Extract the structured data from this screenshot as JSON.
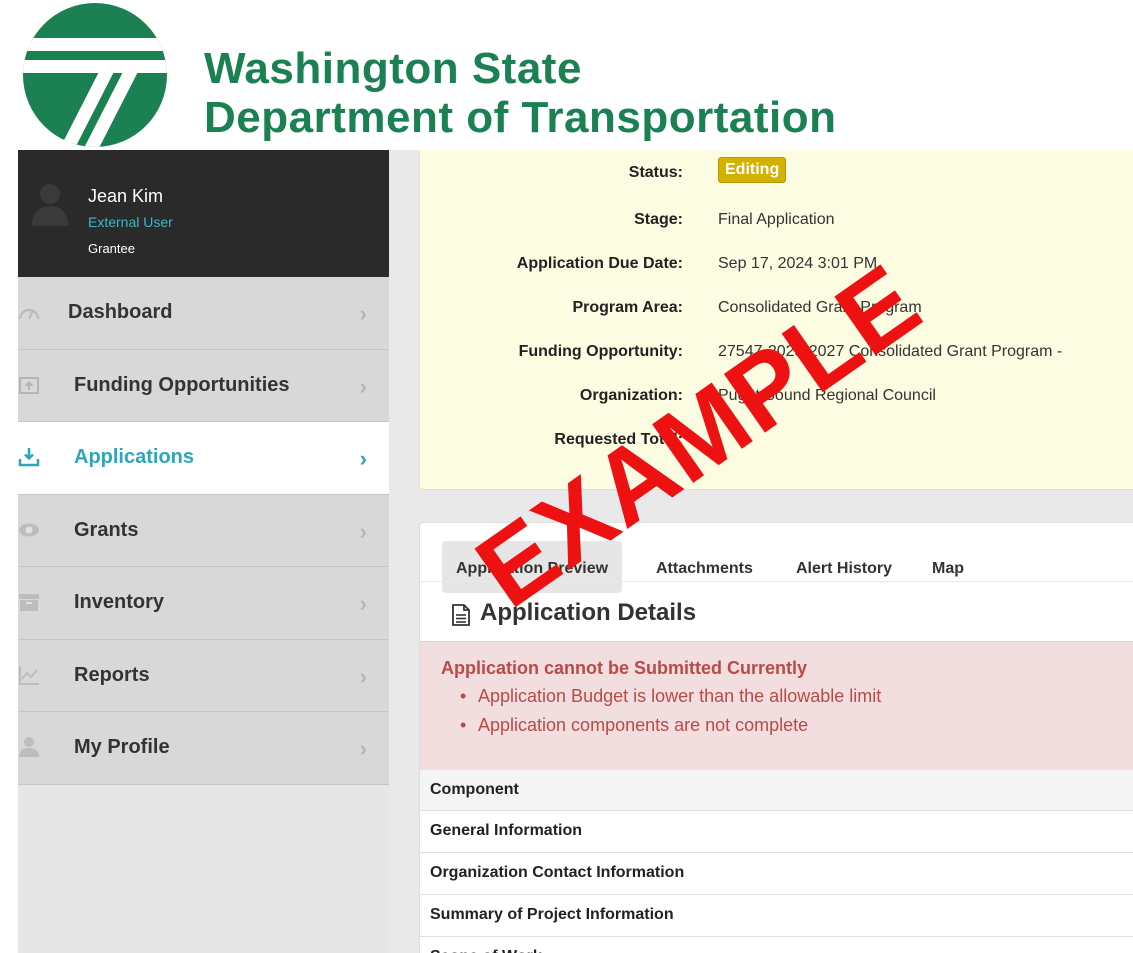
{
  "header": {
    "logo_line1": "Washington State",
    "logo_line2": "Department of Transportation"
  },
  "user": {
    "name": "Jean Kim",
    "role": "External User",
    "type": "Grantee"
  },
  "nav": [
    {
      "label": "Dashboard",
      "icon": "gauge-icon",
      "active": false
    },
    {
      "label": "Funding Opportunities",
      "icon": "upload-tray-icon",
      "active": false
    },
    {
      "label": "Applications",
      "icon": "download-tray-icon",
      "active": true
    },
    {
      "label": "Grants",
      "icon": "eye-icon",
      "active": false
    },
    {
      "label": "Inventory",
      "icon": "archive-icon",
      "active": false
    },
    {
      "label": "Reports",
      "icon": "line-chart-icon",
      "active": false
    },
    {
      "label": "My Profile",
      "icon": "user-icon",
      "active": false
    }
  ],
  "summary": {
    "status_label": "Status:",
    "status_value": "Editing",
    "stage_label": "Stage:",
    "stage_value": "Final Application",
    "due_label": "Application Due Date:",
    "due_value": "Sep 17, 2024 3:01 PM",
    "program_label": "Program Area:",
    "program_value": "Consolidated Grant Program",
    "funding_label": "Funding Opportunity:",
    "funding_value": "27547-2025-2027 Consolidated Grant Program -",
    "org_label": "Organization:",
    "org_value": "Puget Sound Regional Council",
    "total_label": "Requested Total:"
  },
  "tabs": [
    "Application Preview",
    "Attachments",
    "Alert History",
    "Map"
  ],
  "details_title": "Application Details",
  "alert": {
    "title": "Application cannot be Submitted Currently",
    "items": [
      "Application Budget is lower than the allowable limit",
      "Application components are not complete"
    ]
  },
  "table": {
    "header": "Component",
    "rows": [
      "General Information",
      "Organization Contact Information",
      "Summary of Project Information",
      "Scope of Work"
    ]
  },
  "watermark": "EXAMPLE",
  "colors": {
    "brand_green": "#1b8052",
    "accent_teal": "#2aa7bd",
    "status_badge": "#d4b000",
    "alert_text": "#b94a48",
    "watermark_red": "#ee1111"
  }
}
